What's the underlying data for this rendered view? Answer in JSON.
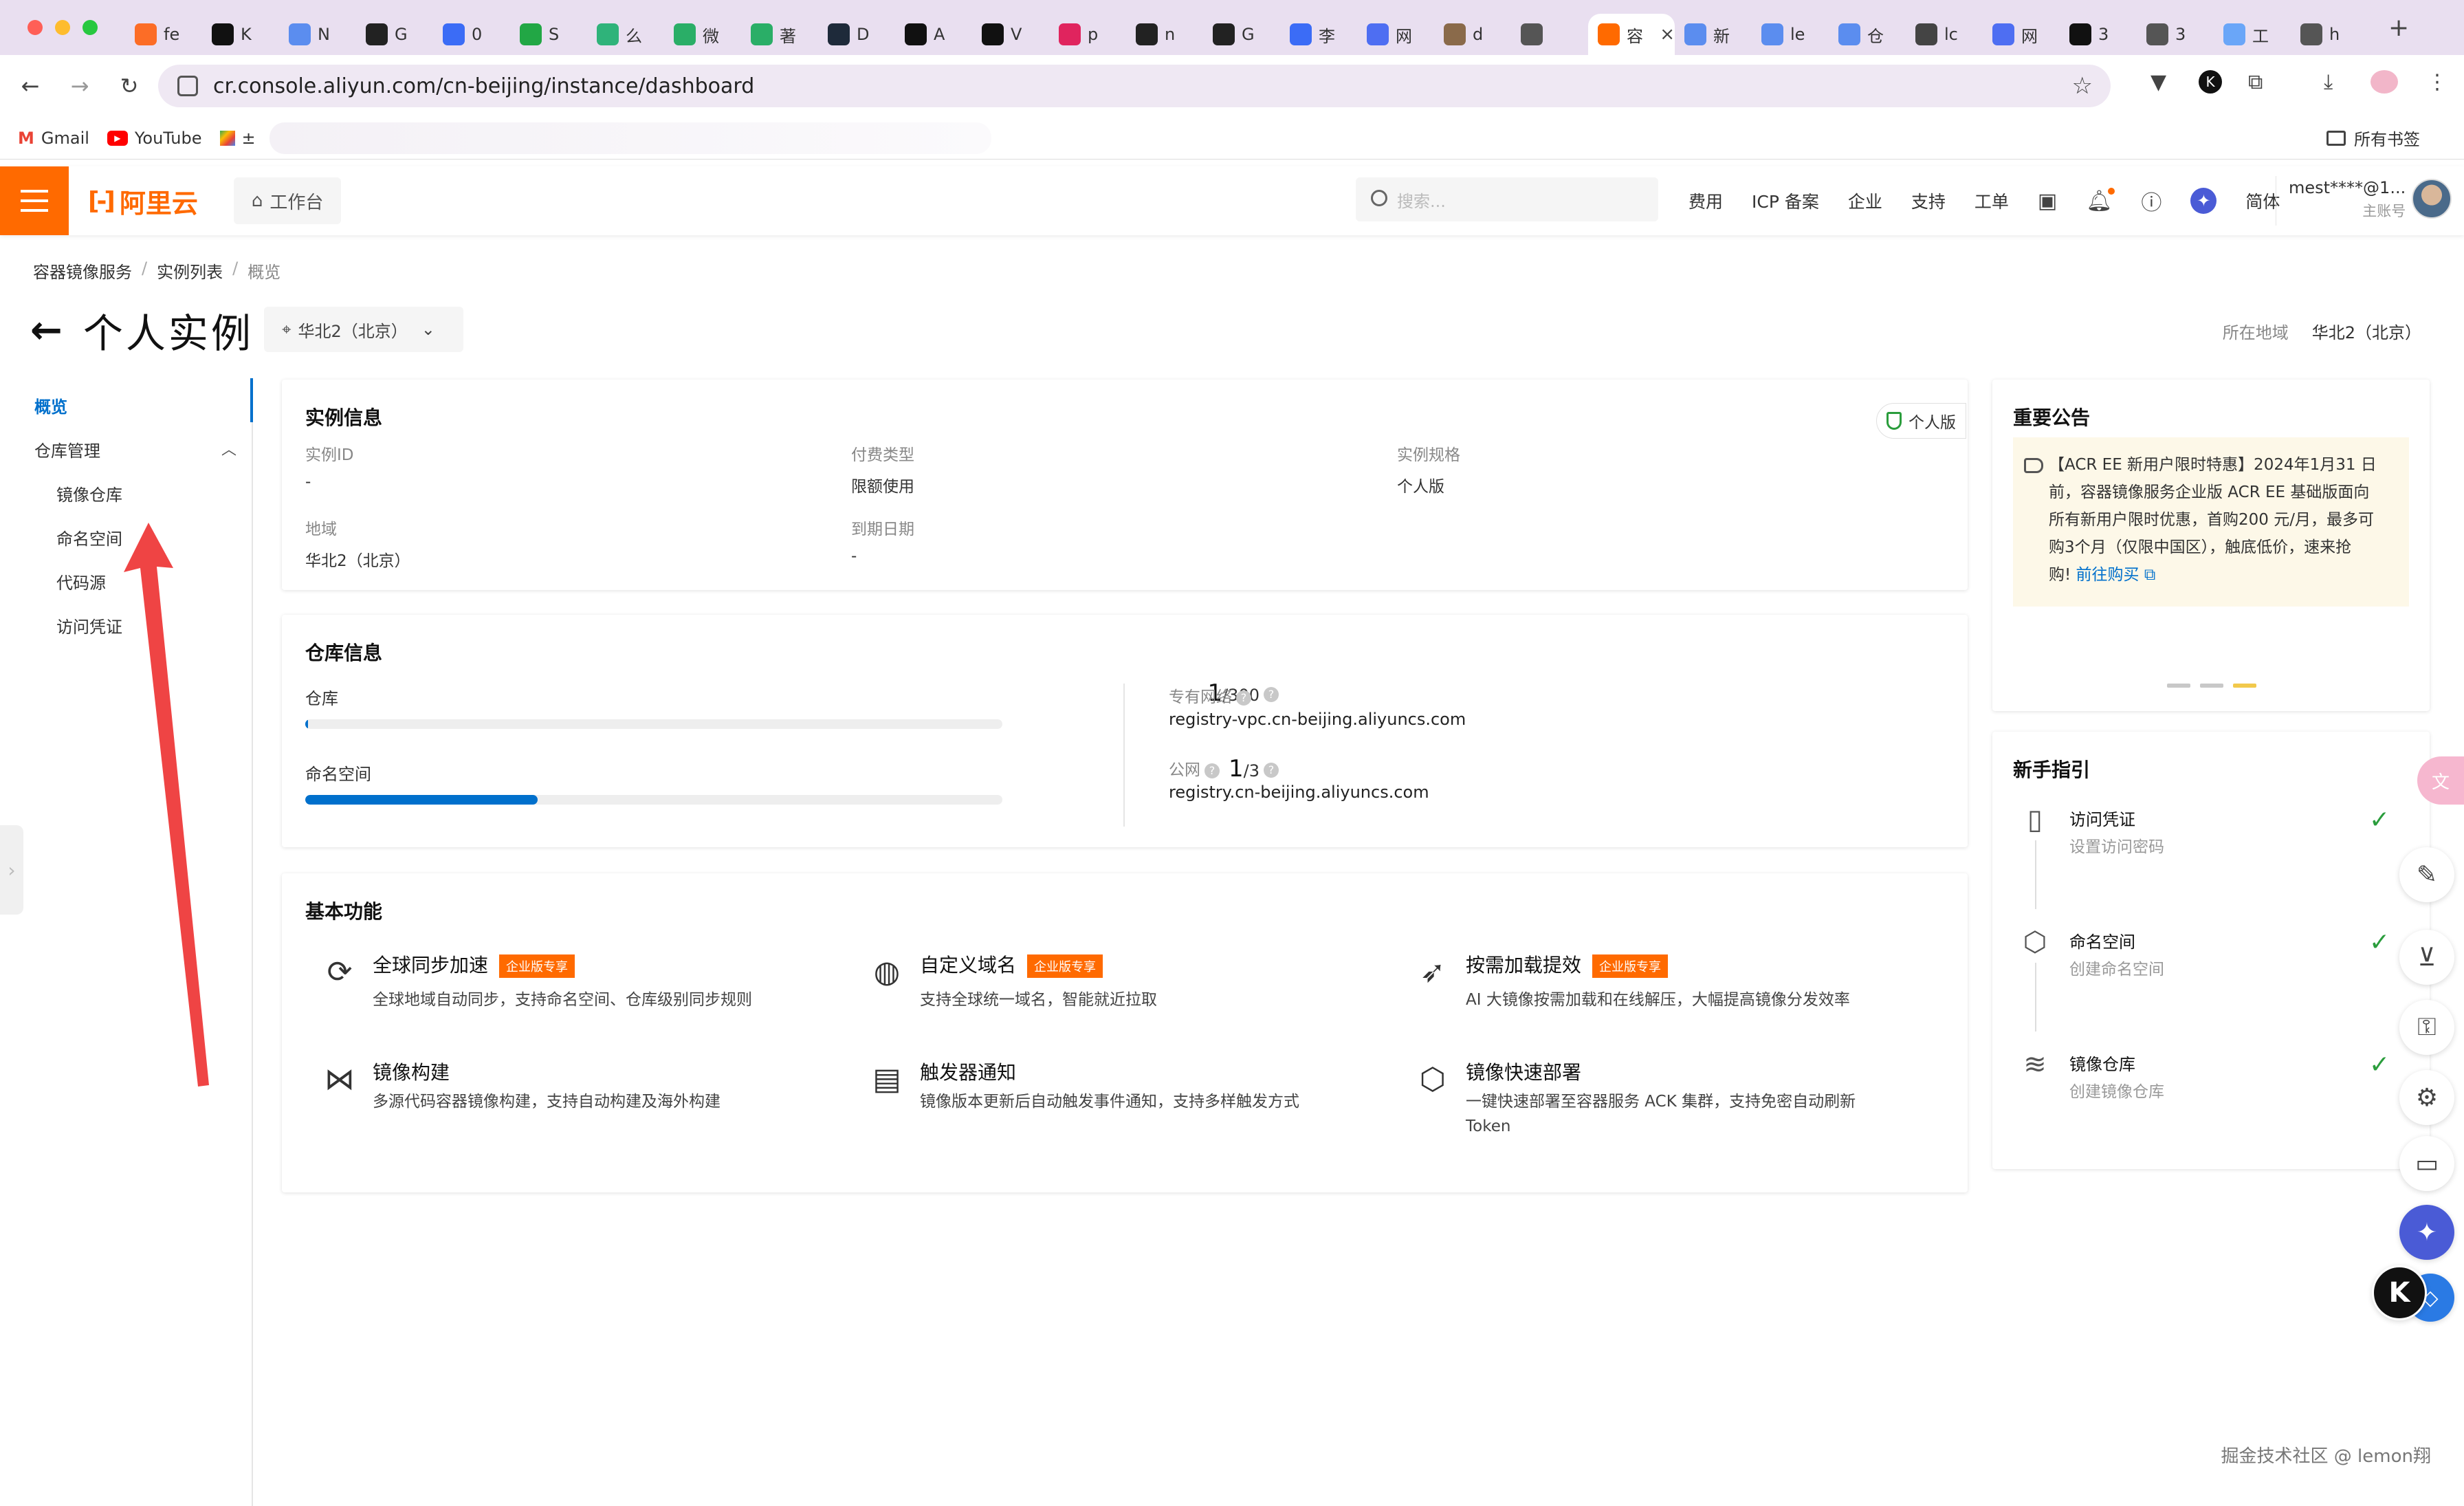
{
  "browser": {
    "tabs": [
      {
        "label": "fe",
        "icon": "gitlab-icon",
        "color": "#fc6d26"
      },
      {
        "label": "K",
        "icon": "k-icon",
        "color": "#111111"
      },
      {
        "label": "N",
        "icon": "chevrons-icon",
        "color": "#5b8def"
      },
      {
        "label": "G",
        "icon": "github-icon",
        "color": "#222222"
      },
      {
        "label": "0",
        "icon": "doc-icon",
        "color": "#3b6cf6"
      },
      {
        "label": "S",
        "icon": "s-icon",
        "color": "#22a745"
      },
      {
        "label": "么",
        "icon": "leaf-icon",
        "color": "#2fb37a"
      },
      {
        "label": "微",
        "icon": "wechat-icon",
        "color": "#2aae67"
      },
      {
        "label": "著",
        "icon": "wechat-icon",
        "color": "#2aae67"
      },
      {
        "label": "D",
        "icon": "hex-icon",
        "color": "#1e2a3a"
      },
      {
        "label": "A",
        "icon": "n-icon",
        "color": "#111111"
      },
      {
        "label": "V",
        "icon": "ui-icon",
        "color": "#111111"
      },
      {
        "label": "p",
        "icon": "bird-icon",
        "color": "#e0245e"
      },
      {
        "label": "n",
        "icon": "github-icon",
        "color": "#222222"
      },
      {
        "label": "G",
        "icon": "github-icon",
        "color": "#222222"
      },
      {
        "label": "李",
        "icon": "doc-icon",
        "color": "#3b6cf6"
      },
      {
        "label": "网",
        "icon": "rocket-icon",
        "color": "#4e6ef2"
      },
      {
        "label": "d",
        "icon": "photo-icon",
        "color": "#8a6a4a"
      },
      {
        "label": "",
        "icon": "circle-icon",
        "color": "#555555"
      },
      {
        "label": "容",
        "icon": "aliyun-icon",
        "color": "#ff6a00",
        "active": true
      },
      {
        "label": "新",
        "icon": "chevrons-icon",
        "color": "#5b8def"
      },
      {
        "label": "le",
        "icon": "chevrons-icon",
        "color": "#5b8def"
      },
      {
        "label": "仓",
        "icon": "chevrons-icon",
        "color": "#5b8def"
      },
      {
        "label": "lc",
        "icon": "spiral-icon",
        "color": "#444444"
      },
      {
        "label": "网",
        "icon": "rocket-icon",
        "color": "#4e6ef2"
      },
      {
        "label": "3",
        "icon": "cx-icon",
        "color": "#111111"
      },
      {
        "label": "3",
        "icon": "globe-icon",
        "color": "#555555"
      },
      {
        "label": "工",
        "icon": "drop-icon",
        "color": "#6aa6f8"
      },
      {
        "label": "h",
        "icon": "globe-icon",
        "color": "#555555"
      }
    ],
    "url": "cr.console.aliyun.com/cn-beijing/instance/dashboard",
    "bookmarks": [
      {
        "label": "Gmail",
        "icon": "gmail-icon"
      },
      {
        "label": "YouTube",
        "icon": "youtube-icon"
      },
      {
        "label": "±",
        "icon": "maps-icon"
      }
    ],
    "all_bookmarks": "所有书签"
  },
  "header": {
    "logo_text": "阿里云",
    "workbench": "工作台",
    "search_placeholder": "搜索...",
    "nav": [
      "费用",
      "ICP 备案",
      "企业",
      "支持",
      "工单"
    ],
    "lang": "简体",
    "account": "mest****@1...",
    "account_sub": "主账号"
  },
  "breadcrumb": [
    "容器镜像服务",
    "实例列表",
    "概览"
  ],
  "page": {
    "title": "个人实例",
    "region_select": "华北2（北京）",
    "region_label": "所在地域",
    "region_value": "华北2（北京）"
  },
  "sidebar": {
    "items": [
      {
        "label": "概览",
        "active": true
      },
      {
        "label": "仓库管理",
        "expandable": true
      },
      {
        "label": "镜像仓库",
        "sub": true
      },
      {
        "label": "命名空间",
        "sub": true
      },
      {
        "label": "代码源",
        "sub": true
      },
      {
        "label": "访问凭证",
        "sub": true
      }
    ]
  },
  "instance_info": {
    "title": "实例信息",
    "badge": "个人版",
    "fields": [
      {
        "label": "实例ID",
        "value": "-"
      },
      {
        "label": "付费类型",
        "value": "限额使用"
      },
      {
        "label": "实例规格",
        "value": "个人版"
      },
      {
        "label": "地域",
        "value": "华北2（北京）"
      },
      {
        "label": "到期日期",
        "value": "-"
      }
    ]
  },
  "repo_info": {
    "title": "仓库信息",
    "stats": [
      {
        "label": "仓库",
        "used": "1",
        "total": "/300",
        "fraction": 0.0033
      },
      {
        "label": "命名空间",
        "used": "1",
        "total": "/3",
        "fraction": 0.333
      }
    ],
    "networks": [
      {
        "label": "专有网络",
        "value": "registry-vpc.cn-beijing.aliyuncs.com"
      },
      {
        "label": "公网",
        "value": "registry.cn-beijing.aliyuncs.com"
      }
    ]
  },
  "features": {
    "title": "基本功能",
    "items": [
      {
        "name": "全球同步加速",
        "tag": "企业版专享",
        "desc": "全球地域自动同步，支持命名空间、仓库级别同步规则",
        "icon": "sync-icon"
      },
      {
        "name": "自定义域名",
        "tag": "企业版专享",
        "desc": "支持全球统一域名，智能就近拉取",
        "icon": "globe-icon"
      },
      {
        "name": "按需加载提效",
        "tag": "企业版专享",
        "desc": "AI 大镜像按需加载和在线解压，大幅提高镜像分发效率",
        "icon": "rocket-icon"
      },
      {
        "name": "镜像构建",
        "tag": "",
        "desc": "多源代码容器镜像构建，支持自动构建及海外构建",
        "icon": "build-icon"
      },
      {
        "name": "触发器通知",
        "tag": "",
        "desc": "镜像版本更新后自动触发事件通知，支持多样触发方式",
        "icon": "notify-icon"
      },
      {
        "name": "镜像快速部署",
        "tag": "",
        "desc_1": "一键快速部署至容器服务 ACK 集群，支持免密自动刷新",
        "desc_2": "Token",
        "icon": "deploy-icon"
      }
    ]
  },
  "announcement": {
    "title": "重要公告",
    "lines": [
      "【ACR EE 新用户限时特惠】2024年1月31 日",
      "前，容器镜像服务企业版 ACR EE 基础版面向",
      "所有新用户限时优惠，首购200 元/月，最多可",
      "购3个月（仅限中国区），触底低价，速来抢"
    ],
    "last_line": "购!",
    "link": "前往购买"
  },
  "guide": {
    "title": "新手指引",
    "steps": [
      {
        "name": "访问凭证",
        "desc": "设置访问密码",
        "icon": "doc-key-icon"
      },
      {
        "name": "命名空间",
        "desc": "创建命名空间",
        "icon": "hexagon-icon"
      },
      {
        "name": "镜像仓库",
        "desc": "创建镜像仓库",
        "icon": "layers-icon"
      }
    ]
  },
  "watermark": "掘金技术社区 @ lemon翔",
  "colors": {
    "brand": "#ff6a00",
    "primary": "#0070cc",
    "success": "#2a9d3c"
  }
}
